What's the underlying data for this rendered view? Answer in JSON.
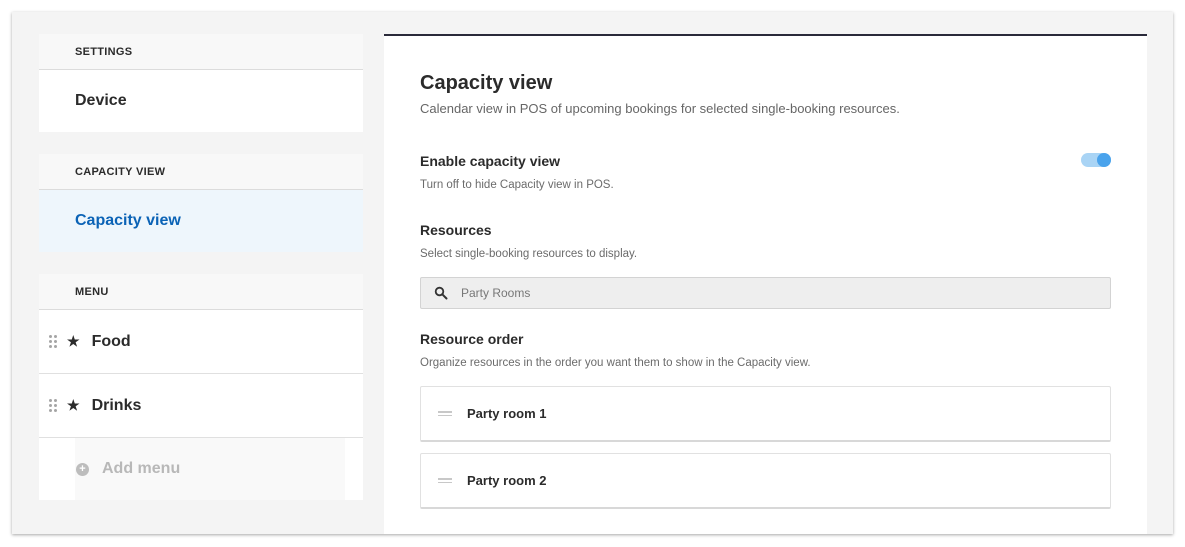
{
  "sidebar": {
    "settings": {
      "header": "SETTINGS",
      "item": "Device"
    },
    "capacity": {
      "header": "CAPACITY VIEW",
      "item": "Capacity view"
    },
    "menu": {
      "header": "MENU",
      "items": [
        {
          "label": "Food",
          "icon": "star-icon"
        },
        {
          "label": "Drinks",
          "icon": "star-icon"
        }
      ],
      "add_label": "Add menu"
    }
  },
  "main": {
    "title": "Capacity view",
    "description": "Calendar view in POS of upcoming bookings for selected single-booking resources.",
    "enable": {
      "title": "Enable capacity view",
      "subtitle": "Turn off to hide Capacity view in POS.",
      "enabled": true
    },
    "resources": {
      "title": "Resources",
      "subtitle": "Select single-booking resources to display.",
      "search_placeholder": "Party Rooms"
    },
    "order": {
      "title": "Resource order",
      "subtitle": "Organize resources in the order you want them to show in the Capacity view.",
      "items": [
        "Party room 1",
        "Party room 2"
      ]
    }
  },
  "colors": {
    "accent": "#0b63b6",
    "active_bg": "#eef6fc",
    "toggle_track": "#a9d4f5",
    "toggle_knob": "#4aa3ec"
  }
}
